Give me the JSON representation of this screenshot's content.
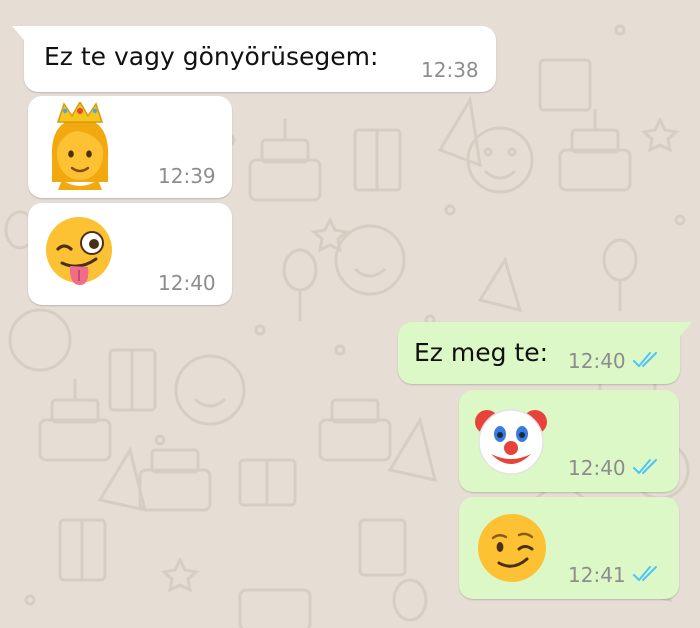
{
  "conversation": {
    "messages": [
      {
        "direction": "incoming",
        "text": "Ez te vagy gönyörüsegem:",
        "time": "12:38"
      },
      {
        "direction": "incoming",
        "emoji": "princess-emoji",
        "time": "12:39"
      },
      {
        "direction": "incoming",
        "emoji": "winking-face-with-tongue-emoji",
        "time": "12:40"
      },
      {
        "direction": "outgoing",
        "text": "Ez meg te:",
        "time": "12:40",
        "status": "read"
      },
      {
        "direction": "outgoing",
        "emoji": "clown-face-emoji",
        "time": "12:40",
        "status": "read"
      },
      {
        "direction": "outgoing",
        "emoji": "winking-face-emoji",
        "time": "12:41",
        "status": "read"
      }
    ]
  },
  "colors": {
    "wallpaper": "#e6ddd4",
    "doodle": "#d6cdc3",
    "incoming_bubble": "#ffffff",
    "outgoing_bubble": "#dcf8c6",
    "read_ticks": "#4fc3f7",
    "timestamp": "#8d8d8d"
  }
}
